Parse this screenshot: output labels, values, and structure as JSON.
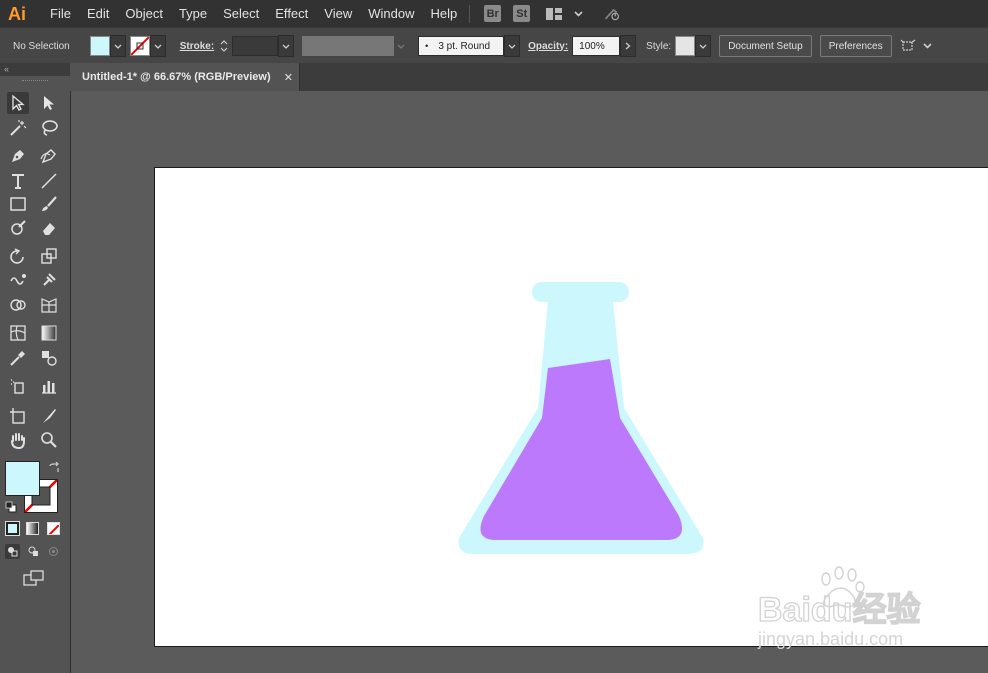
{
  "app": {
    "logo": "Ai"
  },
  "menu": [
    "File",
    "Edit",
    "Object",
    "Type",
    "Select",
    "Effect",
    "View",
    "Window",
    "Help"
  ],
  "app_switchers": [
    "Br",
    "St"
  ],
  "control_bar": {
    "selection_label": "No Selection",
    "stroke_label": "Stroke:",
    "brush_label": "3 pt. Round",
    "opacity_label": "Opacity:",
    "opacity_value": "100%",
    "style_label": "Style:",
    "document_setup": "Document Setup",
    "preferences": "Preferences"
  },
  "document_tab": {
    "title": "Untitled-1* @ 66.67% (RGB/Preview)",
    "close": "✕"
  },
  "tools_panel": {
    "collapse": "«"
  },
  "colors": {
    "fill": "#ccf7fd",
    "flask_glass": "#ccf7fd",
    "flask_liquid": "#bd79fb",
    "app_logo": "#ff9a2e"
  },
  "watermark": {
    "brand": "Baidu经验",
    "url": "jingyan.baidu.com"
  }
}
